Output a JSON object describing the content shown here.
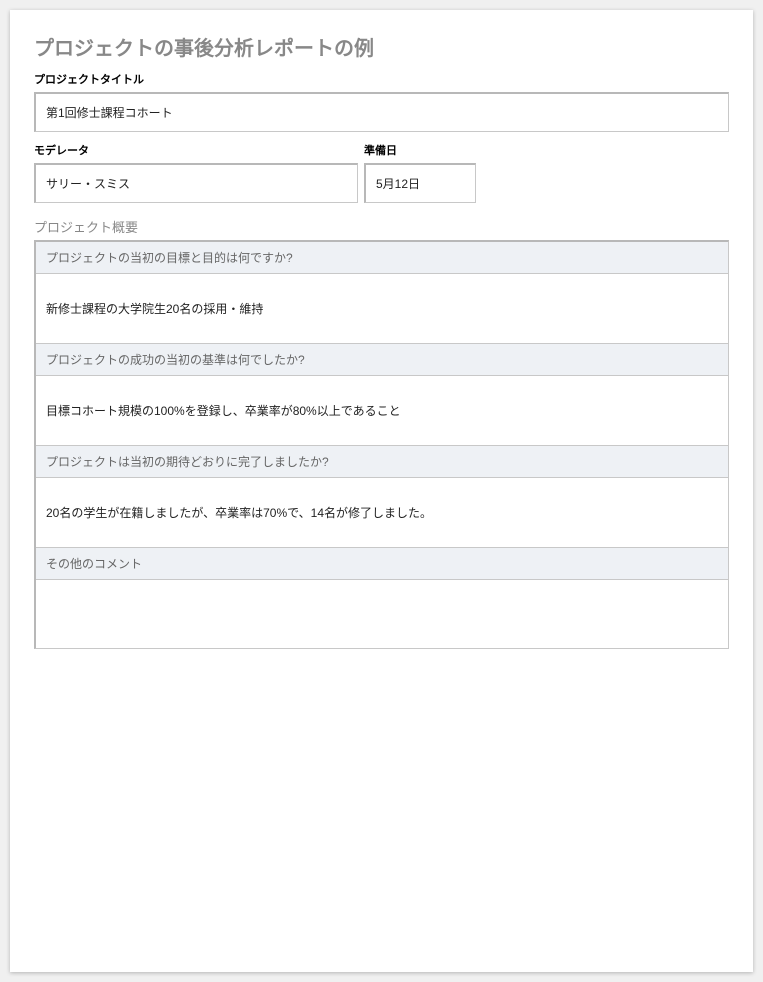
{
  "pageTitle": "プロジェクトの事後分析レポートの例",
  "labels": {
    "projectTitle": "プロジェクトタイトル",
    "moderator": "モデレータ",
    "prepDate": "準備日"
  },
  "fields": {
    "projectTitle": "第1回修士課程コホート",
    "moderator": "サリー・スミス",
    "prepDate": "5月12日"
  },
  "overview": {
    "sectionTitle": "プロジェクト概要",
    "rows": [
      {
        "question": "プロジェクトの当初の目標と目的は何ですか?",
        "answer": "新修士課程の大学院生20名の採用・維持"
      },
      {
        "question": "プロジェクトの成功の当初の基準は何でしたか?",
        "answer": "目標コホート規模の100%を登録し、卒業率が80%以上であること"
      },
      {
        "question": "プロジェクトは当初の期待どおりに完了しましたか?",
        "answer": "20名の学生が在籍しましたが、卒業率は70%で、14名が修了しました。"
      },
      {
        "question": "その他のコメント",
        "answer": ""
      }
    ]
  }
}
